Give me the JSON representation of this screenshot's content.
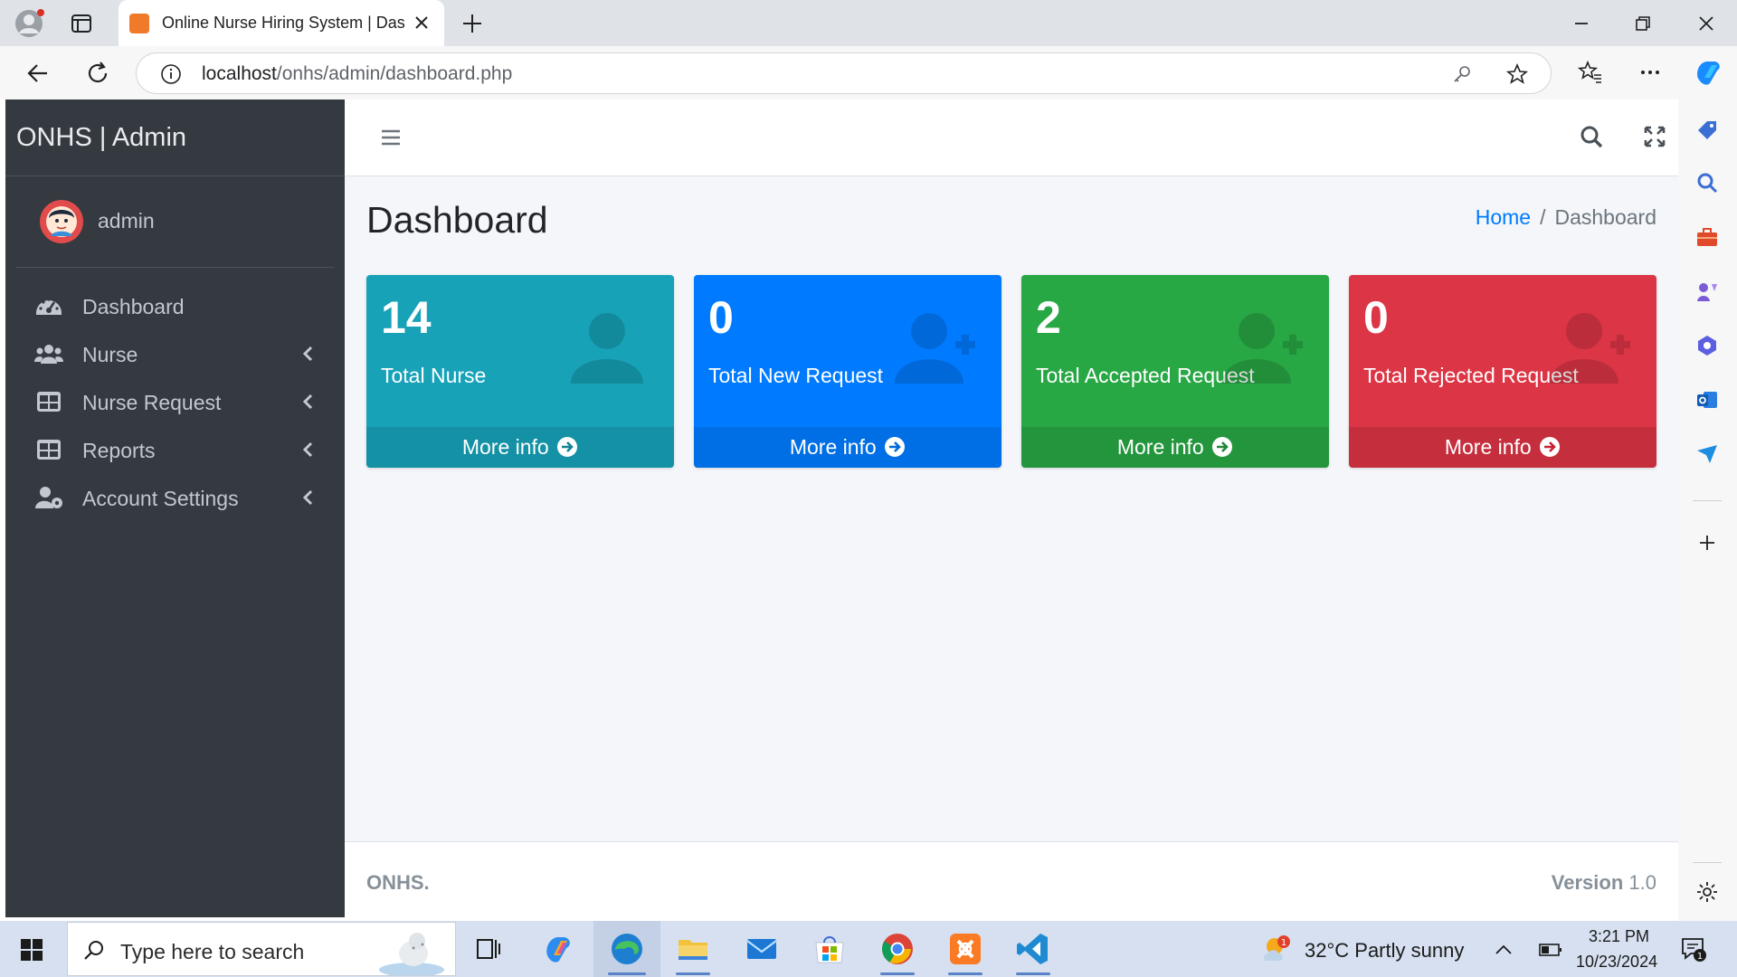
{
  "browser": {
    "tab_title": "Online Nurse Hiring System | Dashboard",
    "url_host": "localhost",
    "url_path": "/onhs/admin/dashboard.php"
  },
  "sidebar": {
    "brand": "ONHS | Admin",
    "username": "admin",
    "items": [
      {
        "label": "Dashboard",
        "icon": "tachometer-icon",
        "has_children": false
      },
      {
        "label": "Nurse",
        "icon": "users-icon",
        "has_children": true
      },
      {
        "label": "Nurse Request",
        "icon": "table-icon",
        "has_children": true
      },
      {
        "label": "Reports",
        "icon": "table-icon",
        "has_children": true
      },
      {
        "label": "Account Settings",
        "icon": "user-cog-icon",
        "has_children": true
      }
    ]
  },
  "content": {
    "title": "Dashboard",
    "breadcrumb": [
      "Home",
      "Dashboard"
    ],
    "boxes": [
      {
        "count": "14",
        "label": "Total Nurse",
        "more": "More info",
        "color": "#17a2b8",
        "icon": "user-icon"
      },
      {
        "count": "0",
        "label": "Total New Request",
        "more": "More info",
        "color": "#007bff",
        "icon": "user-plus-icon"
      },
      {
        "count": "2",
        "label": "Total Accepted Request",
        "more": "More info",
        "color": "#28a745",
        "icon": "user-plus-icon"
      },
      {
        "count": "0",
        "label": "Total Rejected Request",
        "more": "More info",
        "color": "#dc3545",
        "icon": "user-plus-icon"
      }
    ]
  },
  "footer": {
    "brand": "ONHS.",
    "version_label": "Version",
    "version_number": "1.0"
  },
  "taskbar": {
    "search_placeholder": "Type here to search",
    "weather": "32°C  Partly sunny",
    "weather_badge": "1",
    "time": "3:21 PM",
    "date": "10/23/2024",
    "notification_count": "1"
  }
}
